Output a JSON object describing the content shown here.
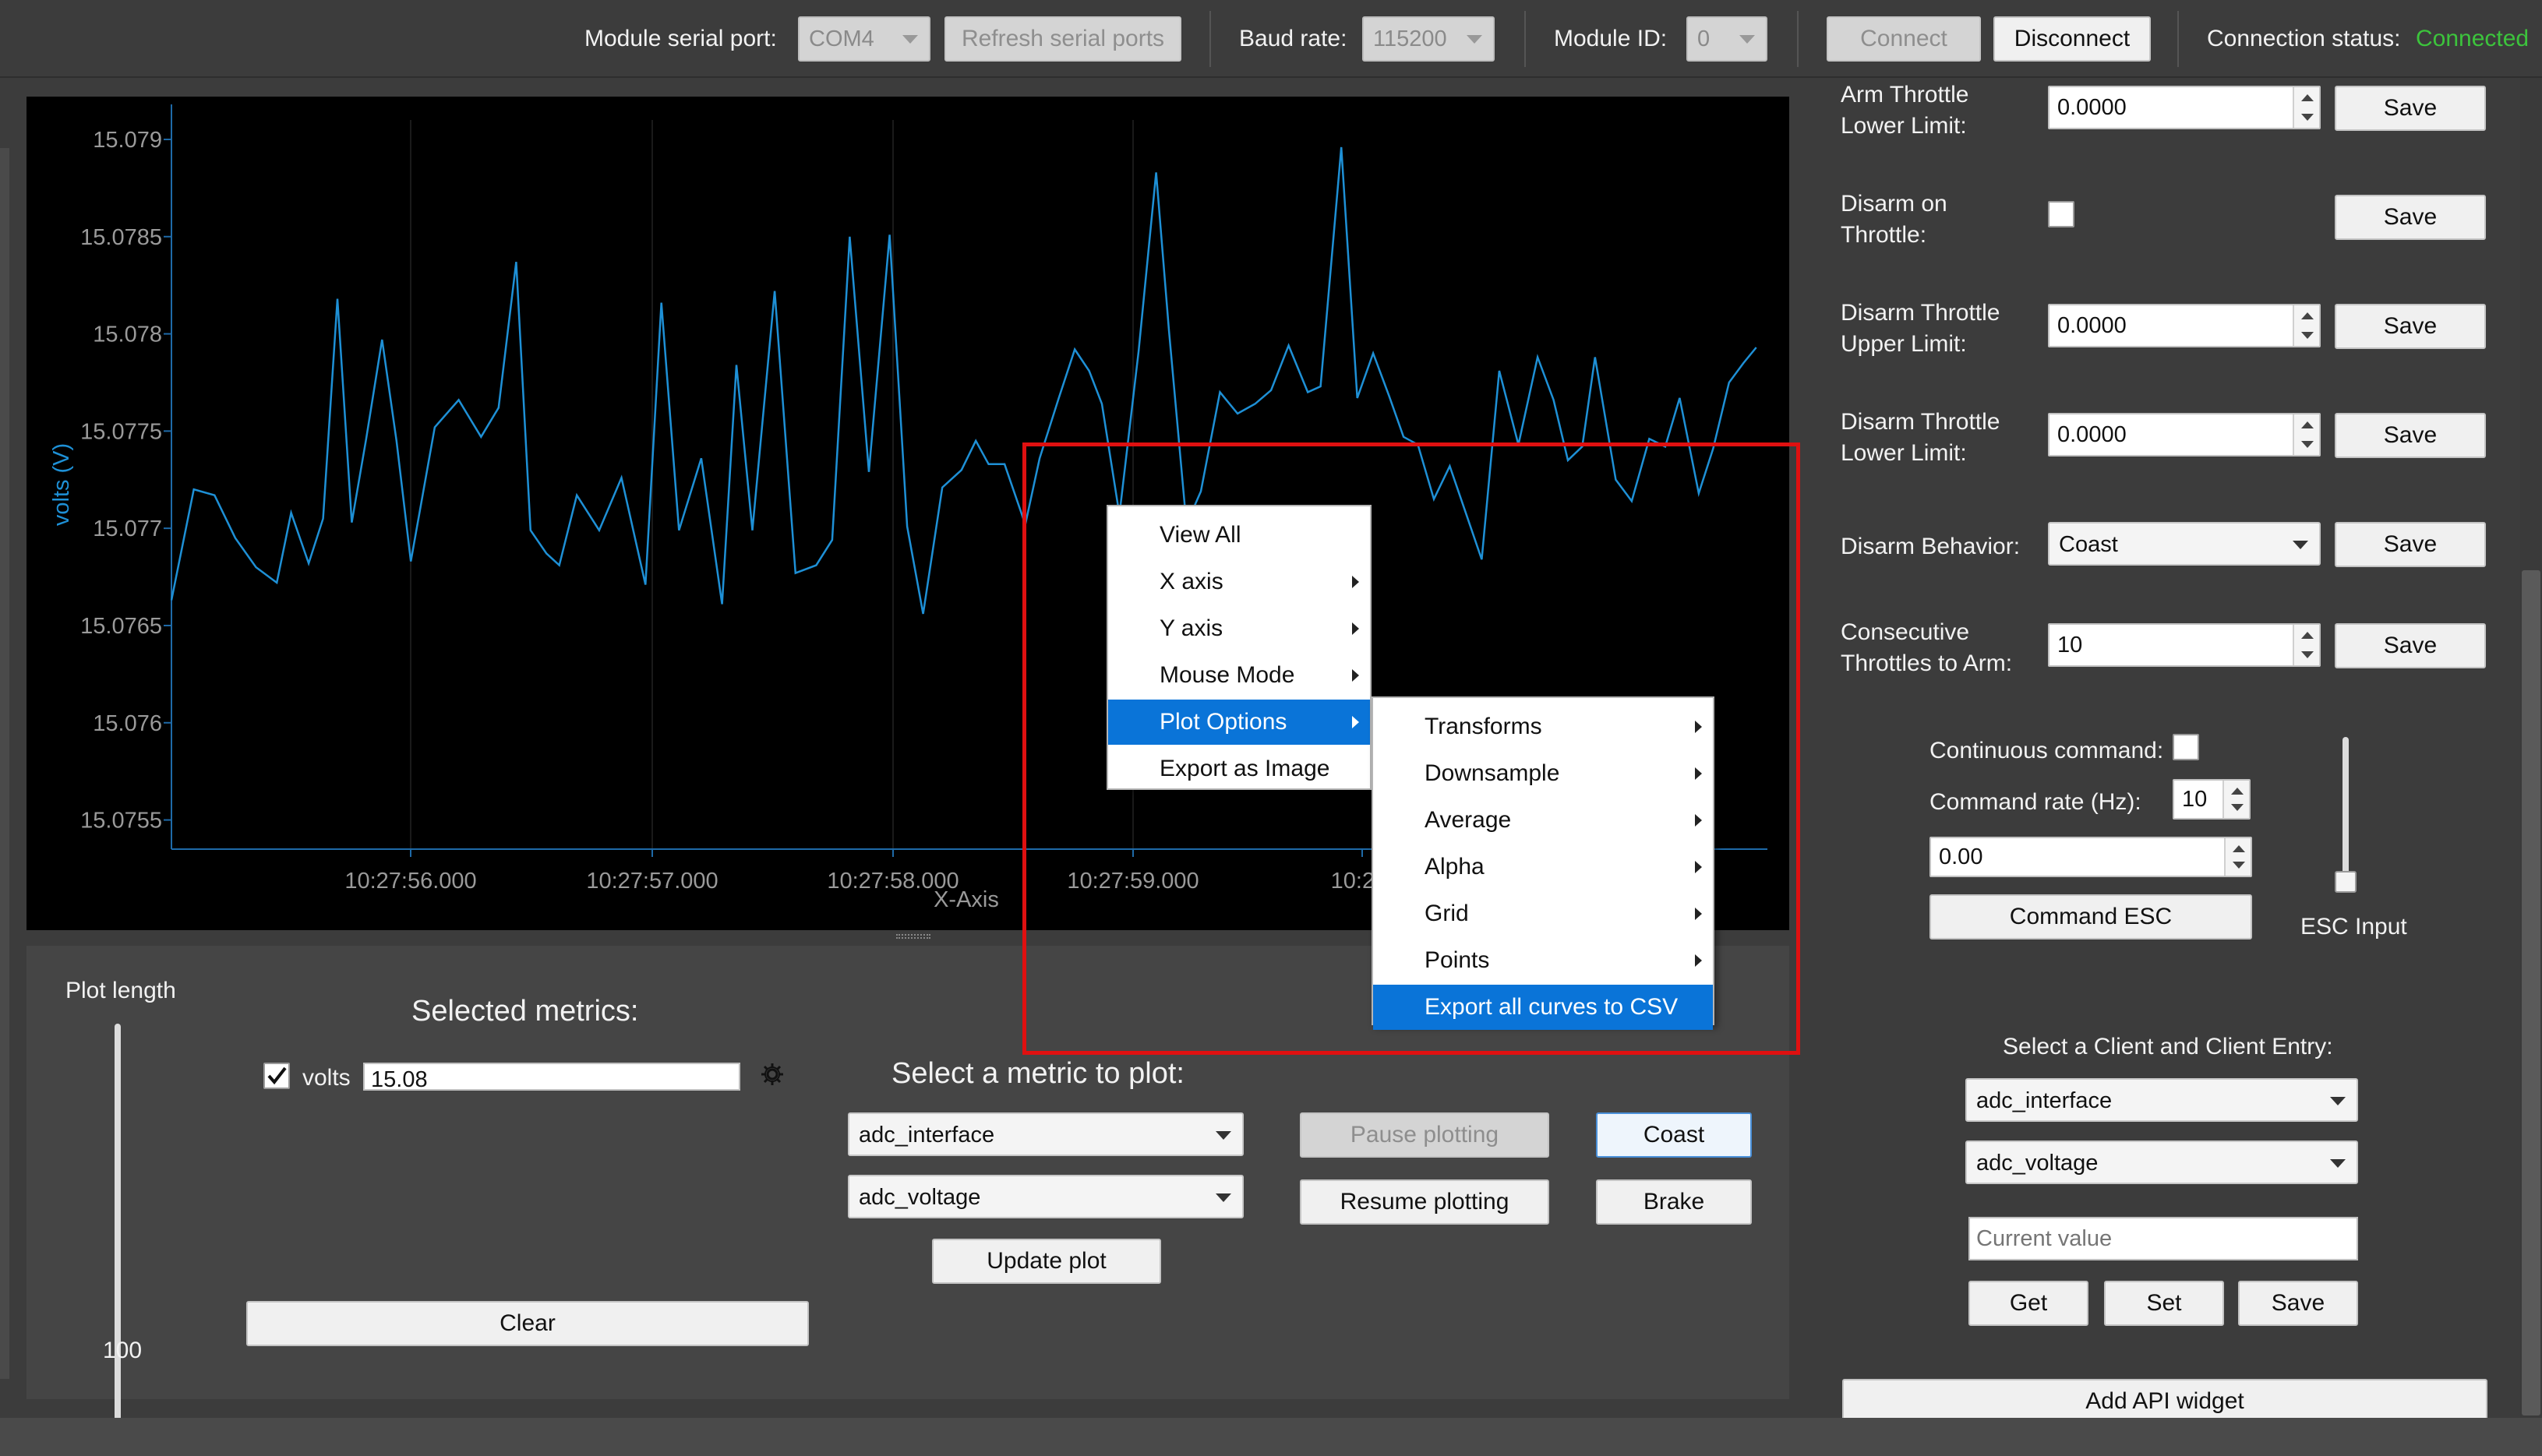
{
  "toolbar": {
    "serial_port_label": "Module serial port:",
    "serial_port_value": "COM4",
    "refresh_label": "Refresh serial ports",
    "baud_label": "Baud rate:",
    "baud_value": "115200",
    "module_id_label": "Module ID:",
    "module_id_value": "0",
    "connect_label": "Connect",
    "disconnect_label": "Disconnect",
    "status_label": "Connection status:",
    "status_value": "Connected",
    "status_color": "#3cc43c"
  },
  "chart_data": {
    "type": "line",
    "ylabel": "volts (V)",
    "xlabel": "X-Axis",
    "y_ticks": [
      "15.079",
      "15.0785",
      "15.078",
      "15.0775",
      "15.077",
      "15.0765",
      "15.076",
      "15.0755"
    ],
    "x_ticks": [
      "10:27:56.000",
      "10:27:57.000",
      "10:27:58.000",
      "10:27:59.000",
      "10:28:"
    ],
    "ylim": [
      15.07535,
      15.0791
    ],
    "xlim": [
      0,
      100
    ],
    "grid": true,
    "line_color": "#1e90d6",
    "series": [
      {
        "x": [
          0,
          1.4,
          2.7,
          4,
          5.3,
          6.6,
          7.5,
          8.6,
          9.5,
          10.4,
          11.3,
          12.2,
          13.2,
          14.1,
          15,
          16.5,
          18,
          19.4,
          20.5,
          21.6,
          22.5,
          23.5,
          24.3,
          25.4,
          26.8,
          28.2,
          29.7,
          30.7,
          31.8,
          33.2,
          34.5,
          35.4,
          36.4,
          37.8,
          39.1,
          40.4,
          41.4,
          42.5,
          43.7,
          45,
          46.1,
          47.1,
          48.3,
          49.5,
          50.4,
          51.2,
          52.2,
          53.5,
          54.4,
          55.6,
          56.6,
          57.5,
          58.3,
          59.4,
          60.6,
          61.7,
          62.5,
          63.6,
          64.5,
          65.7,
          66.8,
          67.9,
          68.9,
          70,
          71.2,
          72,
          73.3,
          74.3,
          75.3,
          76.3,
          77.2,
          78.1,
          79.1,
          80.1,
          81.1,
          82.1,
          83.2,
          84.4,
          85.6,
          86.6,
          87.5,
          88.4,
          89.2,
          90.5,
          91.5,
          92.6,
          93.6,
          94.5,
          95.7,
          96.6,
          97.6,
          98.5,
          99.3
        ],
        "y": [
          15.07663,
          15.0772,
          15.07717,
          15.07695,
          15.0768,
          15.07672,
          15.07708,
          15.07682,
          15.07705,
          15.07818,
          15.07703,
          15.07746,
          15.07797,
          15.07745,
          15.07683,
          15.07752,
          15.07766,
          15.07747,
          15.07762,
          15.07837,
          15.07699,
          15.07687,
          15.07681,
          15.07717,
          15.07699,
          15.07726,
          15.07671,
          15.07816,
          15.07699,
          15.07736,
          15.07661,
          15.07784,
          15.07699,
          15.07822,
          15.07677,
          15.07681,
          15.07694,
          15.0785,
          15.07729,
          15.07851,
          15.07701,
          15.07656,
          15.07721,
          15.0773,
          15.07745,
          15.07733,
          15.07733,
          15.07702,
          15.07736,
          15.07767,
          15.07792,
          15.07781,
          15.07764,
          15.07707,
          15.07791,
          15.07883,
          15.07802,
          15.07702,
          15.07719,
          15.0777,
          15.07759,
          15.07764,
          15.07771,
          15.07794,
          15.0777,
          15.07773,
          15.07896,
          15.07767,
          15.0779,
          15.07768,
          15.07747,
          15.07743,
          15.07715,
          15.07732,
          15.07708,
          15.07684,
          15.07781,
          15.07743,
          15.07788,
          15.07766,
          15.07735,
          15.07742,
          15.07788,
          15.07725,
          15.07714,
          15.07746,
          15.07742,
          15.07767,
          15.07718,
          15.07741,
          15.07775,
          15.07785,
          15.07793
        ]
      }
    ]
  },
  "context_menu": {
    "items": [
      {
        "label": "View All",
        "submenu": false
      },
      {
        "label": "X axis",
        "submenu": true
      },
      {
        "label": "Y axis",
        "submenu": true
      },
      {
        "label": "Mouse Mode",
        "submenu": true
      },
      {
        "label": "Plot Options",
        "submenu": true,
        "selected": true
      },
      {
        "label": "Export as Image",
        "submenu": false
      }
    ],
    "submenu": [
      {
        "label": "Transforms",
        "submenu": true
      },
      {
        "label": "Downsample",
        "submenu": true
      },
      {
        "label": "Average",
        "submenu": true
      },
      {
        "label": "Alpha",
        "submenu": true
      },
      {
        "label": "Grid",
        "submenu": true
      },
      {
        "label": "Points",
        "submenu": true
      },
      {
        "label": "Export all curves to CSV",
        "submenu": false,
        "selected": true
      }
    ]
  },
  "highlight_color": "#e01010",
  "bottom": {
    "plot_length_label": "Plot length",
    "plot_length_value": "100",
    "plot_length_fraction": 0.06,
    "selected_metrics_title": "Selected metrics:",
    "metric_name": "volts",
    "metric_value": "15.08",
    "clear_label": "Clear",
    "select_metric_title": "Select a metric to plot:",
    "metric_combo_1": "adc_interface",
    "metric_combo_2": "adc_voltage",
    "update_plot_label": "Update plot",
    "pause_label": "Pause plotting",
    "resume_label": "Resume plotting",
    "coast_label": "Coast",
    "brake_label": "Brake"
  },
  "right": {
    "rows": [
      {
        "label": "Arm Throttle\nLower Limit:",
        "value": "0.0000",
        "save": "Save"
      },
      {
        "label": "Disarm on\nThrottle:",
        "save": "Save"
      },
      {
        "label": "Disarm Throttle\nUpper Limit:",
        "value": "0.0000",
        "save": "Save"
      },
      {
        "label": "Disarm Throttle\nLower Limit:",
        "value": "0.0000",
        "save": "Save"
      },
      {
        "label": "Disarm Behavior:",
        "value": "Coast",
        "save": "Save"
      },
      {
        "label": "Consecutive\nThrottles to Arm:",
        "value": "10",
        "save": "Save"
      }
    ],
    "continuous_label": "Continuous command:",
    "rate_label": "Command rate (Hz):",
    "rate_value": "10",
    "command_value": "0.00",
    "command_esc_label": "Command ESC",
    "esc_input_label": "ESC Input",
    "client_title": "Select a Client and Client Entry:",
    "client_combo": "adc_interface",
    "entry_combo": "adc_voltage",
    "current_value_placeholder": "Current value",
    "get_label": "Get",
    "set_label": "Set",
    "save_label": "Save",
    "add_widget_label": "Add API widget"
  }
}
